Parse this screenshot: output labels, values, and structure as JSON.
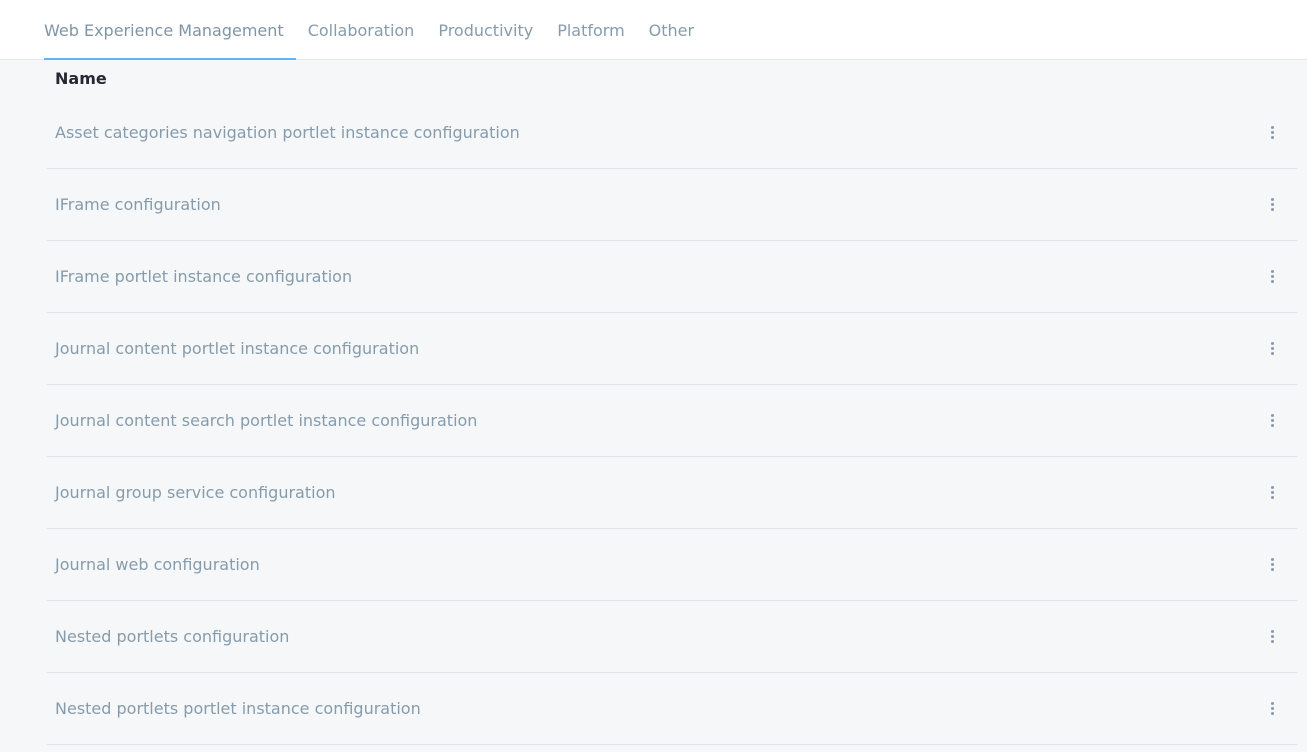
{
  "tabs": [
    {
      "label": "Web Experience Management",
      "active": true
    },
    {
      "label": "Collaboration",
      "active": false
    },
    {
      "label": "Productivity",
      "active": false
    },
    {
      "label": "Platform",
      "active": false
    },
    {
      "label": "Other",
      "active": false
    }
  ],
  "table": {
    "header_name": "Name",
    "rows": [
      {
        "label": "Asset categories navigation portlet instance configuration",
        "actions_icon": "kebab-icon"
      },
      {
        "label": "IFrame configuration",
        "actions_icon": "kebab-icon"
      },
      {
        "label": "IFrame portlet instance configuration",
        "actions_icon": "kebab-icon"
      },
      {
        "label": "Journal content portlet instance configuration",
        "actions_icon": "kebab-icon"
      },
      {
        "label": "Journal content search portlet instance configuration",
        "actions_icon": "kebab-icon"
      },
      {
        "label": "Journal group service configuration",
        "actions_icon": "kebab-icon"
      },
      {
        "label": "Journal web configuration",
        "actions_icon": "kebab-icon"
      },
      {
        "label": "Nested portlets configuration",
        "actions_icon": "kebab-icon"
      },
      {
        "label": "Nested portlets portlet instance configuration",
        "actions_icon": "kebab-icon"
      }
    ]
  },
  "colors": {
    "active_tab_indicator": "#64b5f6",
    "text_muted": "#869cad",
    "header_text": "#272833",
    "background": "#f6f7f8"
  }
}
